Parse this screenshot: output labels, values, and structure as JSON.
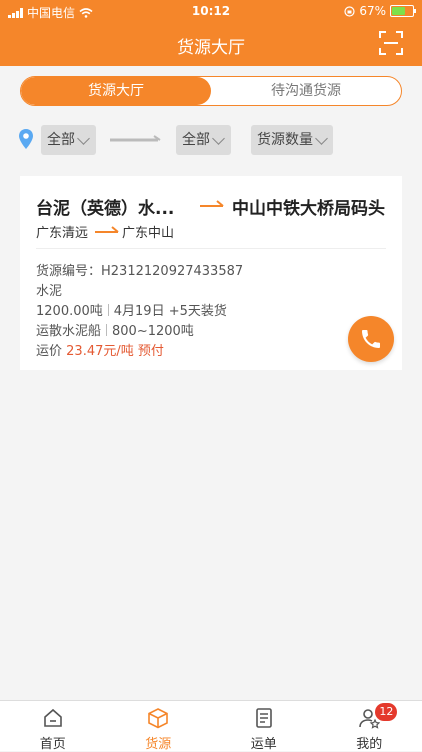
{
  "status_bar": {
    "carrier": "中国电信",
    "time": "10:12",
    "battery": "67%"
  },
  "header": {
    "title": "货源大厅",
    "scan_icon": "scan-icon"
  },
  "segment": {
    "tabs": [
      {
        "label": "货源大厅",
        "active": true
      },
      {
        "label": "待沟通货源",
        "active": false
      }
    ]
  },
  "filters": {
    "from": "全部",
    "to": "全部",
    "quantity": "货源数量"
  },
  "cargo": {
    "from_port": "台泥（英德）水...",
    "to_port": "中山中铁大桥局码头",
    "from_region": "广东清远",
    "to_region": "广东中山",
    "id_label": "货源编号：",
    "id_value": "H2312120927433587",
    "goods": "水泥",
    "tonnage": "1200.00吨",
    "load_date": "4月19日 +5天装货",
    "ship_type": "运散水泥船",
    "ship_range": "800~1200吨",
    "freight_label": "运价",
    "freight_value": "23.47元/吨 预付"
  },
  "tabbar": {
    "items": [
      {
        "label": "首页",
        "icon": "home-icon"
      },
      {
        "label": "货源",
        "icon": "box-icon"
      },
      {
        "label": "运单",
        "icon": "document-icon"
      },
      {
        "label": "我的",
        "icon": "user-star-icon"
      }
    ],
    "active_index": 1,
    "badge": "12"
  },
  "colors": {
    "accent": "#f5862a",
    "price": "#e45a33",
    "badge": "#e4392c"
  }
}
